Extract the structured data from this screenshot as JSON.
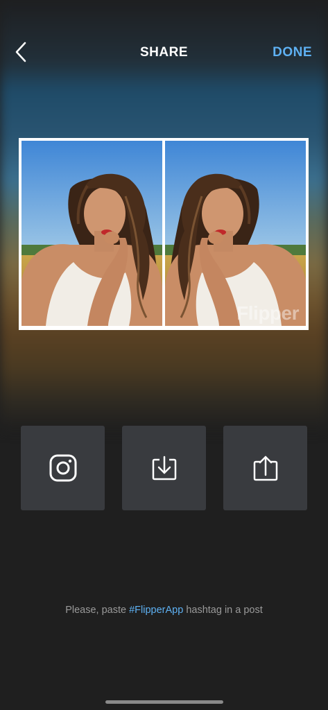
{
  "header": {
    "back_icon": "chevron-left-icon",
    "title": "SHARE",
    "done_label": "DONE"
  },
  "photo": {
    "watermark": "Flipper"
  },
  "actions": [
    {
      "icon": "instagram-icon",
      "name": "instagram-share-button"
    },
    {
      "icon": "download-icon",
      "name": "save-button"
    },
    {
      "icon": "share-icon",
      "name": "share-button"
    }
  ],
  "hint": {
    "prefix": "Please, paste ",
    "tag": "#FlipperApp",
    "suffix": " hashtag in a post"
  },
  "colors": {
    "accent": "#5eb1f3",
    "background": "#1f1f1f",
    "button_bg": "#393b3f"
  }
}
